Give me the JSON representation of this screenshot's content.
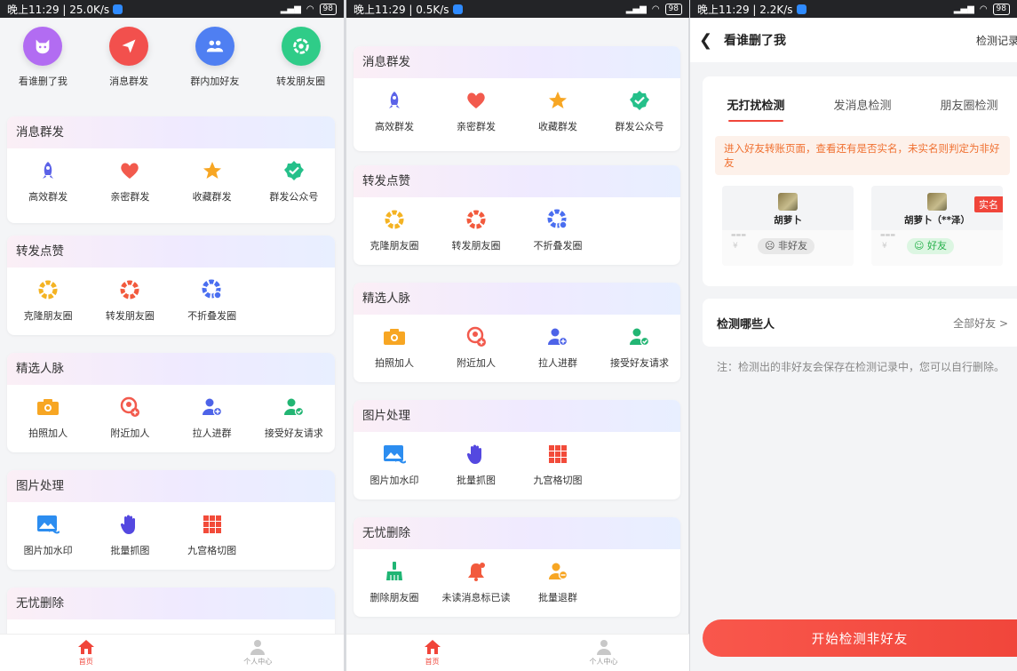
{
  "screen1": {
    "status": {
      "text": "晚上11:29 | 25.0K/s",
      "battery": "98"
    },
    "quick": [
      {
        "label": "看谁删了我",
        "icon": "cat-icon",
        "color": "#b26cf2"
      },
      {
        "label": "消息群发",
        "icon": "paper-plane-icon",
        "color": "#f2504d"
      },
      {
        "label": "群内加好友",
        "icon": "group-icon",
        "color": "#4f7ff2"
      },
      {
        "label": "转发朋友圈",
        "icon": "aperture-icon",
        "color": "#2fcc88"
      }
    ],
    "sections": [
      {
        "title": "消息群发",
        "items": [
          {
            "label": "高效群发",
            "icon": "rocket-icon"
          },
          {
            "label": "亲密群发",
            "icon": "heart-icon"
          },
          {
            "label": "收藏群发",
            "icon": "star-icon"
          },
          {
            "label": "群发公众号",
            "icon": "verified-badge-icon"
          }
        ]
      },
      {
        "title": "转发点赞",
        "items": [
          {
            "label": "克隆朋友圈",
            "icon": "aperture-gold-icon"
          },
          {
            "label": "转发朋友圈",
            "icon": "aperture-red-icon"
          },
          {
            "label": "不折叠发圈",
            "icon": "aperture-blue-icon"
          }
        ]
      },
      {
        "title": "精选人脉",
        "items": [
          {
            "label": "拍照加人",
            "icon": "camera-icon"
          },
          {
            "label": "附近加人",
            "icon": "nearby-add-icon"
          },
          {
            "label": "拉人进群",
            "icon": "add-person-icon"
          },
          {
            "label": "接受好友请求",
            "icon": "accept-friend-icon"
          }
        ]
      },
      {
        "title": "图片处理",
        "items": [
          {
            "label": "图片加水印",
            "icon": "image-watermark-icon"
          },
          {
            "label": "批量抓图",
            "icon": "hand-icon"
          },
          {
            "label": "九宫格切图",
            "icon": "grid-icon"
          }
        ]
      },
      {
        "title": "无忧删除",
        "items": []
      }
    ],
    "tabs": [
      {
        "label": "首页"
      },
      {
        "label": "个人中心"
      }
    ]
  },
  "screen2": {
    "status": {
      "text": "晚上11:29 | 0.5K/s",
      "battery": "98"
    },
    "sections": [
      {
        "title": "消息群发",
        "items": [
          {
            "label": "高效群发"
          },
          {
            "label": "亲密群发"
          },
          {
            "label": "收藏群发"
          },
          {
            "label": "群发公众号"
          }
        ]
      },
      {
        "title": "转发点赞",
        "items": [
          {
            "label": "克隆朋友圈"
          },
          {
            "label": "转发朋友圈"
          },
          {
            "label": "不折叠发圈"
          }
        ]
      },
      {
        "title": "精选人脉",
        "items": [
          {
            "label": "拍照加人"
          },
          {
            "label": "附近加人"
          },
          {
            "label": "拉人进群"
          },
          {
            "label": "接受好友请求"
          }
        ]
      },
      {
        "title": "图片处理",
        "items": [
          {
            "label": "图片加水印"
          },
          {
            "label": "批量抓图"
          },
          {
            "label": "九宫格切图"
          }
        ]
      },
      {
        "title": "无忧删除",
        "items": [
          {
            "label": "删除朋友圈",
            "icon": "broom-icon"
          },
          {
            "label": "未读消息标已读",
            "icon": "bell-icon"
          },
          {
            "label": "批量退群",
            "icon": "leave-group-icon"
          }
        ]
      }
    ],
    "tabs": [
      {
        "label": "首页"
      },
      {
        "label": "个人中心"
      }
    ]
  },
  "screen3": {
    "status": {
      "text": "晚上11:29 | 2.2K/s",
      "battery": "98"
    },
    "nav": {
      "title": "看谁删了我",
      "right": "检测记录"
    },
    "modes": [
      {
        "label": "无打扰检测"
      },
      {
        "label": "发消息检测"
      },
      {
        "label": "朋友圈检测"
      }
    ],
    "tip": "进入好友转账页面，查看还有是否实名，未实名则判定为非好友",
    "demo_left": {
      "name": "胡萝卜",
      "badge": "☹ 非好友"
    },
    "demo_right": {
      "name": "胡萝卜（**泽）",
      "badge": "☺ 好友",
      "tag": "实名"
    },
    "who": {
      "label": "检测哪些人",
      "value": "全部好友 >"
    },
    "note": "注：检测出的非好友会保存在检测记录中，您可以自行删除。",
    "start": "开始检测非好友"
  },
  "colors": {
    "accent": "#f0453a",
    "tip_bg": "#fdf1ea",
    "tip_text": "#f07030",
    "friend_green": "#26b04a"
  }
}
